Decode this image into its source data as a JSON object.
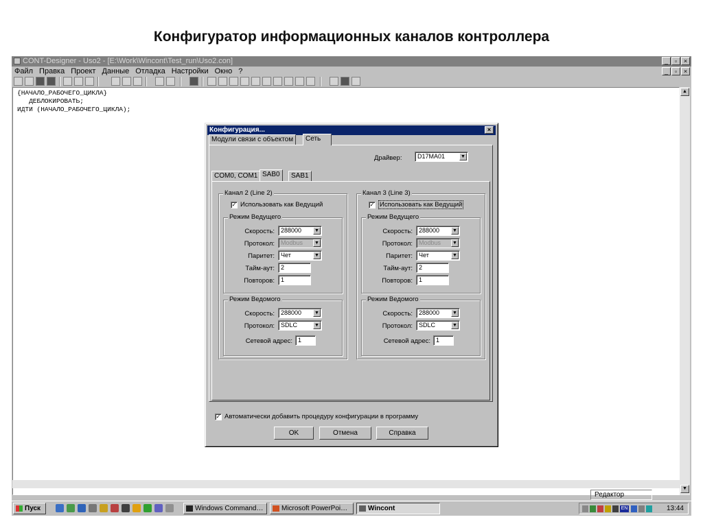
{
  "slide": {
    "title": "Конфигуратор информационных каналов контроллера"
  },
  "window": {
    "title": "CONT-Designer - Uso2 - [E:\\Work\\Wincont\\Test_run\\Uso2.con]",
    "menu": [
      "Файл",
      "Правка",
      "Проект",
      "Данные",
      "Отладка",
      "Настройки",
      "Окно",
      "?"
    ],
    "code": [
      "{НАЧАЛО_РАБОЧЕГО_ЦИКЛА}",
      "   ДЕБЛОКИРОВАТЬ;",
      "ИДТИ (НАЧАЛО_РАБОЧЕГО_ЦИКЛА);"
    ],
    "status": "Редактор"
  },
  "taskbar": {
    "start": "Пуск",
    "tasks": [
      "Windows Command…",
      "Microsoft PowerPoi…",
      "Wincont"
    ],
    "tray_lang": "EN",
    "clock": "13:44"
  },
  "dialog": {
    "title": "Конфигурация...",
    "outer_tabs": [
      "Модули связи с объектом",
      "Сеть"
    ],
    "driver_label": "Драйвер:",
    "driver_value": "D17MA01",
    "inner_tabs": [
      "COM0, COM1",
      "SAB0",
      "SAB1"
    ],
    "channels": [
      {
        "title": "Канал 2 (Line 2)",
        "use_master": "Использовать как Ведущий",
        "use_master_checked": true,
        "master_group": "Режим Ведущего",
        "speed_label": "Скорость:",
        "speed": "288000",
        "protocol_label": "Протокол:",
        "protocol": "Modbus",
        "parity_label": "Паритет:",
        "parity": "Чет",
        "timeout_label": "Тайм-аут:",
        "timeout": "2",
        "retries_label": "Повторов:",
        "retries": "1",
        "slave_group": "Режим Ведомого",
        "slave_speed_label": "Скорость:",
        "slave_speed": "288000",
        "slave_protocol_label": "Протокол:",
        "slave_protocol": "SDLC",
        "net_addr_label": "Сетевой адрес:",
        "net_addr": "1"
      },
      {
        "title": "Канал 3 (Line 3)",
        "use_master": "Использовать как Ведущий",
        "use_master_checked": true,
        "master_group": "Режим Ведущего",
        "speed_label": "Скорость:",
        "speed": "288000",
        "protocol_label": "Протокол:",
        "protocol": "Modbus",
        "parity_label": "Паритет:",
        "parity": "Чет",
        "timeout_label": "Тайм-аут:",
        "timeout": "2",
        "retries_label": "Повторов:",
        "retries": "1",
        "slave_group": "Режим Ведомого",
        "slave_speed_label": "Скорость:",
        "slave_speed": "288000",
        "slave_protocol_label": "Протокол:",
        "slave_protocol": "SDLC",
        "net_addr_label": "Сетевой адрес:",
        "net_addr": "1"
      }
    ],
    "auto_add": "Автоматически добавить процедуру конфигурации в программу",
    "auto_add_checked": true,
    "buttons": {
      "ok": "OK",
      "cancel": "Отмена",
      "help": "Справка"
    }
  }
}
